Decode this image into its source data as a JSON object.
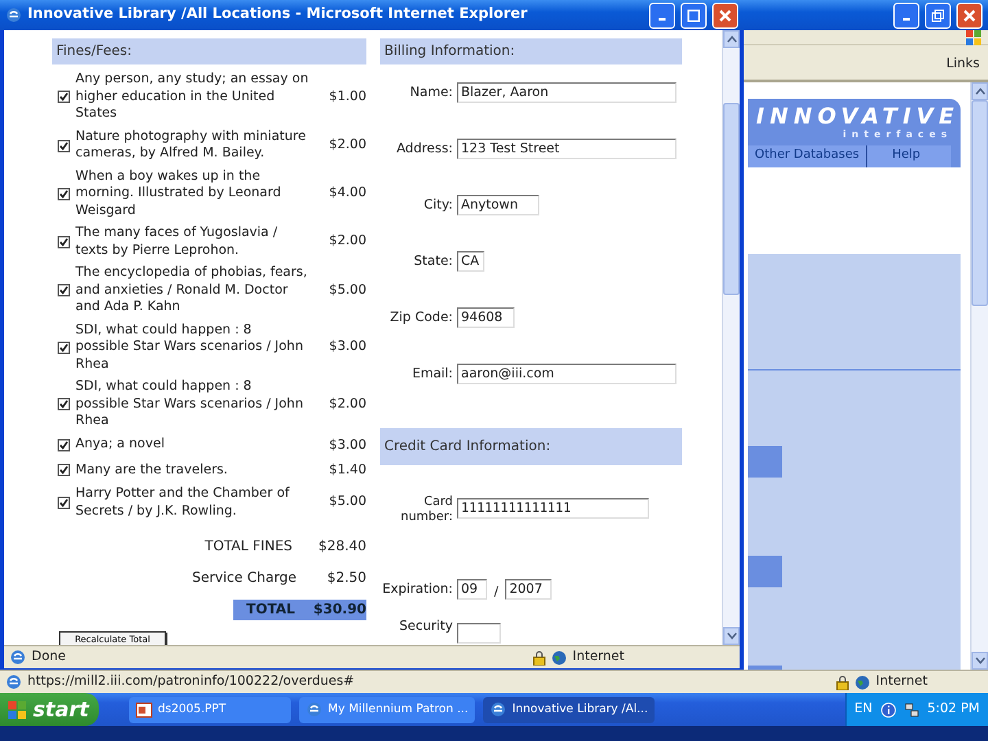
{
  "background_window": {
    "links_label": "Links",
    "logo_title": "INNOVATIVE",
    "logo_subtitle": "interfaces",
    "nav": [
      "Other Databases",
      "Help"
    ],
    "status_url": "https://mill2.iii.com/patroninfo/100222/overdues#",
    "status_zone": "Internet"
  },
  "popup": {
    "title": "Innovative Library /All Locations - Microsoft Internet Explorer",
    "fines_heading": "Fines/Fees:",
    "fines": [
      {
        "title": "Any person, any study; an essay on higher education in the United States",
        "amount": "$1.00",
        "checked": true
      },
      {
        "title": "Nature photography with miniature cameras, by Alfred M. Bailey.",
        "amount": "$2.00",
        "checked": true
      },
      {
        "title": "When a boy wakes up in the morning. Illustrated by Leonard Weisgard",
        "amount": "$4.00",
        "checked": true
      },
      {
        "title": "The many faces of Yugoslavia / texts by Pierre Leprohon.",
        "amount": "$2.00",
        "checked": true
      },
      {
        "title": "The encyclopedia of phobias, fears, and anxieties / Ronald M. Doctor and Ada P. Kahn",
        "amount": "$5.00",
        "checked": true
      },
      {
        "title": "SDI, what could happen : 8 possible Star Wars scenarios / John Rhea",
        "amount": "$3.00",
        "checked": true
      },
      {
        "title": "SDI, what could happen : 8 possible Star Wars scenarios / John Rhea",
        "amount": "$2.00",
        "checked": true
      },
      {
        "title": "Anya; a novel",
        "amount": "$3.00",
        "checked": true
      },
      {
        "title": "Many are the travelers.",
        "amount": "$1.40",
        "checked": true
      },
      {
        "title": "Harry Potter and the Chamber of Secrets / by J.K. Rowling.",
        "amount": "$5.00",
        "checked": true
      }
    ],
    "totals": [
      {
        "label": "TOTAL FINES",
        "amount": "$28.40",
        "kind": "plain"
      },
      {
        "label": "Service Charge",
        "amount": "$2.50",
        "kind": "plain"
      },
      {
        "label": "TOTAL",
        "amount": "$30.90",
        "kind": "grand"
      }
    ],
    "recalc_button": "Recalculate Total",
    "billing_heading": "Billing Information:",
    "billing_fields": [
      {
        "label": "Name:",
        "value": "Blazer, Aaron",
        "kind": "wide"
      },
      {
        "label": "Address:",
        "value": "123 Test Street",
        "kind": "wide"
      },
      {
        "label": "City:",
        "value": "Anytown",
        "kind": "medium"
      },
      {
        "label": "State:",
        "value": "CA",
        "kind": "tiny"
      },
      {
        "label": "Zip Code:",
        "value": "94608",
        "kind": "small"
      },
      {
        "label": "Email:",
        "value": "aaron@iii.com",
        "kind": "wide"
      }
    ],
    "card_heading": "Credit Card Information:",
    "card_number": {
      "label": "Card number:",
      "value": "11111111111111"
    },
    "expiration": {
      "label": "Expiration:",
      "month": "09",
      "separator": "/",
      "year": "2007"
    },
    "security_label": "Security",
    "status": {
      "text": "Done",
      "zone": "Internet"
    }
  },
  "taskbar": {
    "start": "start",
    "tasks": [
      {
        "label": "ds2005.PPT",
        "selected": false
      },
      {
        "label": "My Millennium Patron ...",
        "selected": false
      },
      {
        "label": "Innovative Library /Al...",
        "selected": true
      }
    ],
    "language": "EN",
    "clock": "5:02 PM"
  }
}
